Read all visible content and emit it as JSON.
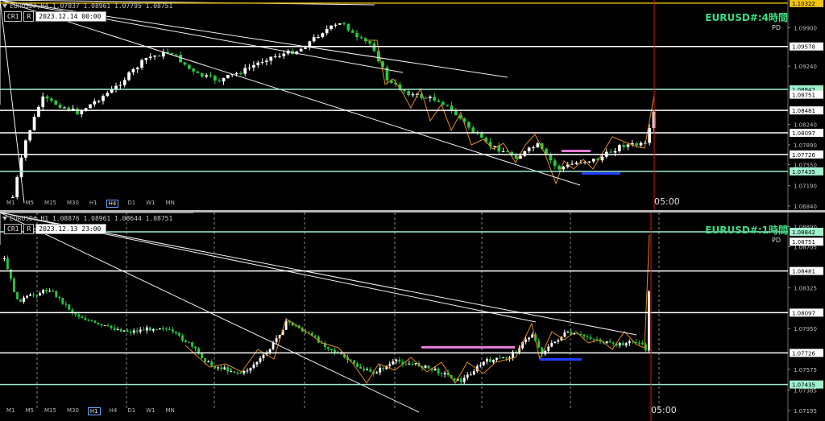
{
  "top": {
    "header": "EURUSD#,H4  1.07837 1.08961 1.07795 1.08751",
    "buttons": [
      "CR1",
      "R"
    ],
    "datetime": "2023.12.14 00:00",
    "title": "EURUSD#:4時間",
    "pd": "PD",
    "timeframes": [
      "M1",
      "M5",
      "M15",
      "M30",
      "H1",
      "H4",
      "D1",
      "W1",
      "MN"
    ],
    "active_tf": "H4",
    "time_label": "05:00",
    "axis": {
      "min": 1.0684,
      "max": 1.1032
    },
    "ticks": [
      "1.09900",
      "1.09240",
      "1.08240",
      "1.07890",
      "1.07550",
      "1.07190",
      "1.06840"
    ],
    "levels": [
      {
        "value": 1.10322,
        "label": "1.10322",
        "kind": "yellow"
      },
      {
        "value": 1.09578,
        "label": "1.09578",
        "kind": "white"
      },
      {
        "value": 1.08842,
        "label": "1.08842",
        "kind": "green"
      },
      {
        "value": 1.08751,
        "label": "1.08751",
        "kind": "price"
      },
      {
        "value": 1.08481,
        "label": "1.08481",
        "kind": "white"
      },
      {
        "value": 1.08097,
        "label": "1.08097",
        "kind": "white"
      },
      {
        "value": 1.07726,
        "label": "1.07726",
        "kind": "white"
      },
      {
        "value": 1.07435,
        "label": "1.07435",
        "kind": "green"
      }
    ]
  },
  "bottom": {
    "header": "EURUSD#,H1  1.08876 1.08961 1.08644 1.08751",
    "buttons": [
      "CR1",
      "R"
    ],
    "datetime": "2023.12.13 23:00",
    "title": "EURUSD#:1時間",
    "pd": "PD",
    "timeframes": [
      "M1",
      "M5",
      "M15",
      "M30",
      "H1",
      "H4",
      "D1",
      "W1",
      "MN"
    ],
    "active_tf": "H1",
    "time_label": "05:00",
    "axis": {
      "min": 1.07195,
      "max": 1.0899
    },
    "ticks": [
      "1.08890",
      "1.08705",
      "1.08325",
      "1.07950",
      "1.07575",
      "1.07385",
      "1.07195"
    ],
    "levels": [
      {
        "value": 1.08842,
        "label": "1.08842",
        "kind": "green"
      },
      {
        "value": 1.08751,
        "label": "1.08751",
        "kind": "price"
      },
      {
        "value": 1.08481,
        "label": "1.08481",
        "kind": "white"
      },
      {
        "value": 1.08097,
        "label": "1.08097",
        "kind": "white"
      },
      {
        "value": 1.07726,
        "label": "1.07726",
        "kind": "white"
      },
      {
        "value": 1.07435,
        "label": "1.07435",
        "kind": "green"
      }
    ]
  },
  "colors": {
    "bull": "#ffffff",
    "bear": "#27c93f",
    "zigzag": "#e08a1e",
    "level_white": "#ffffff",
    "level_green": "#9ff0cf",
    "marker_pink": "#e57ad6",
    "marker_blue": "#1f3dff",
    "vline": "#d21a1a",
    "title_green": "#3ddc84"
  }
}
